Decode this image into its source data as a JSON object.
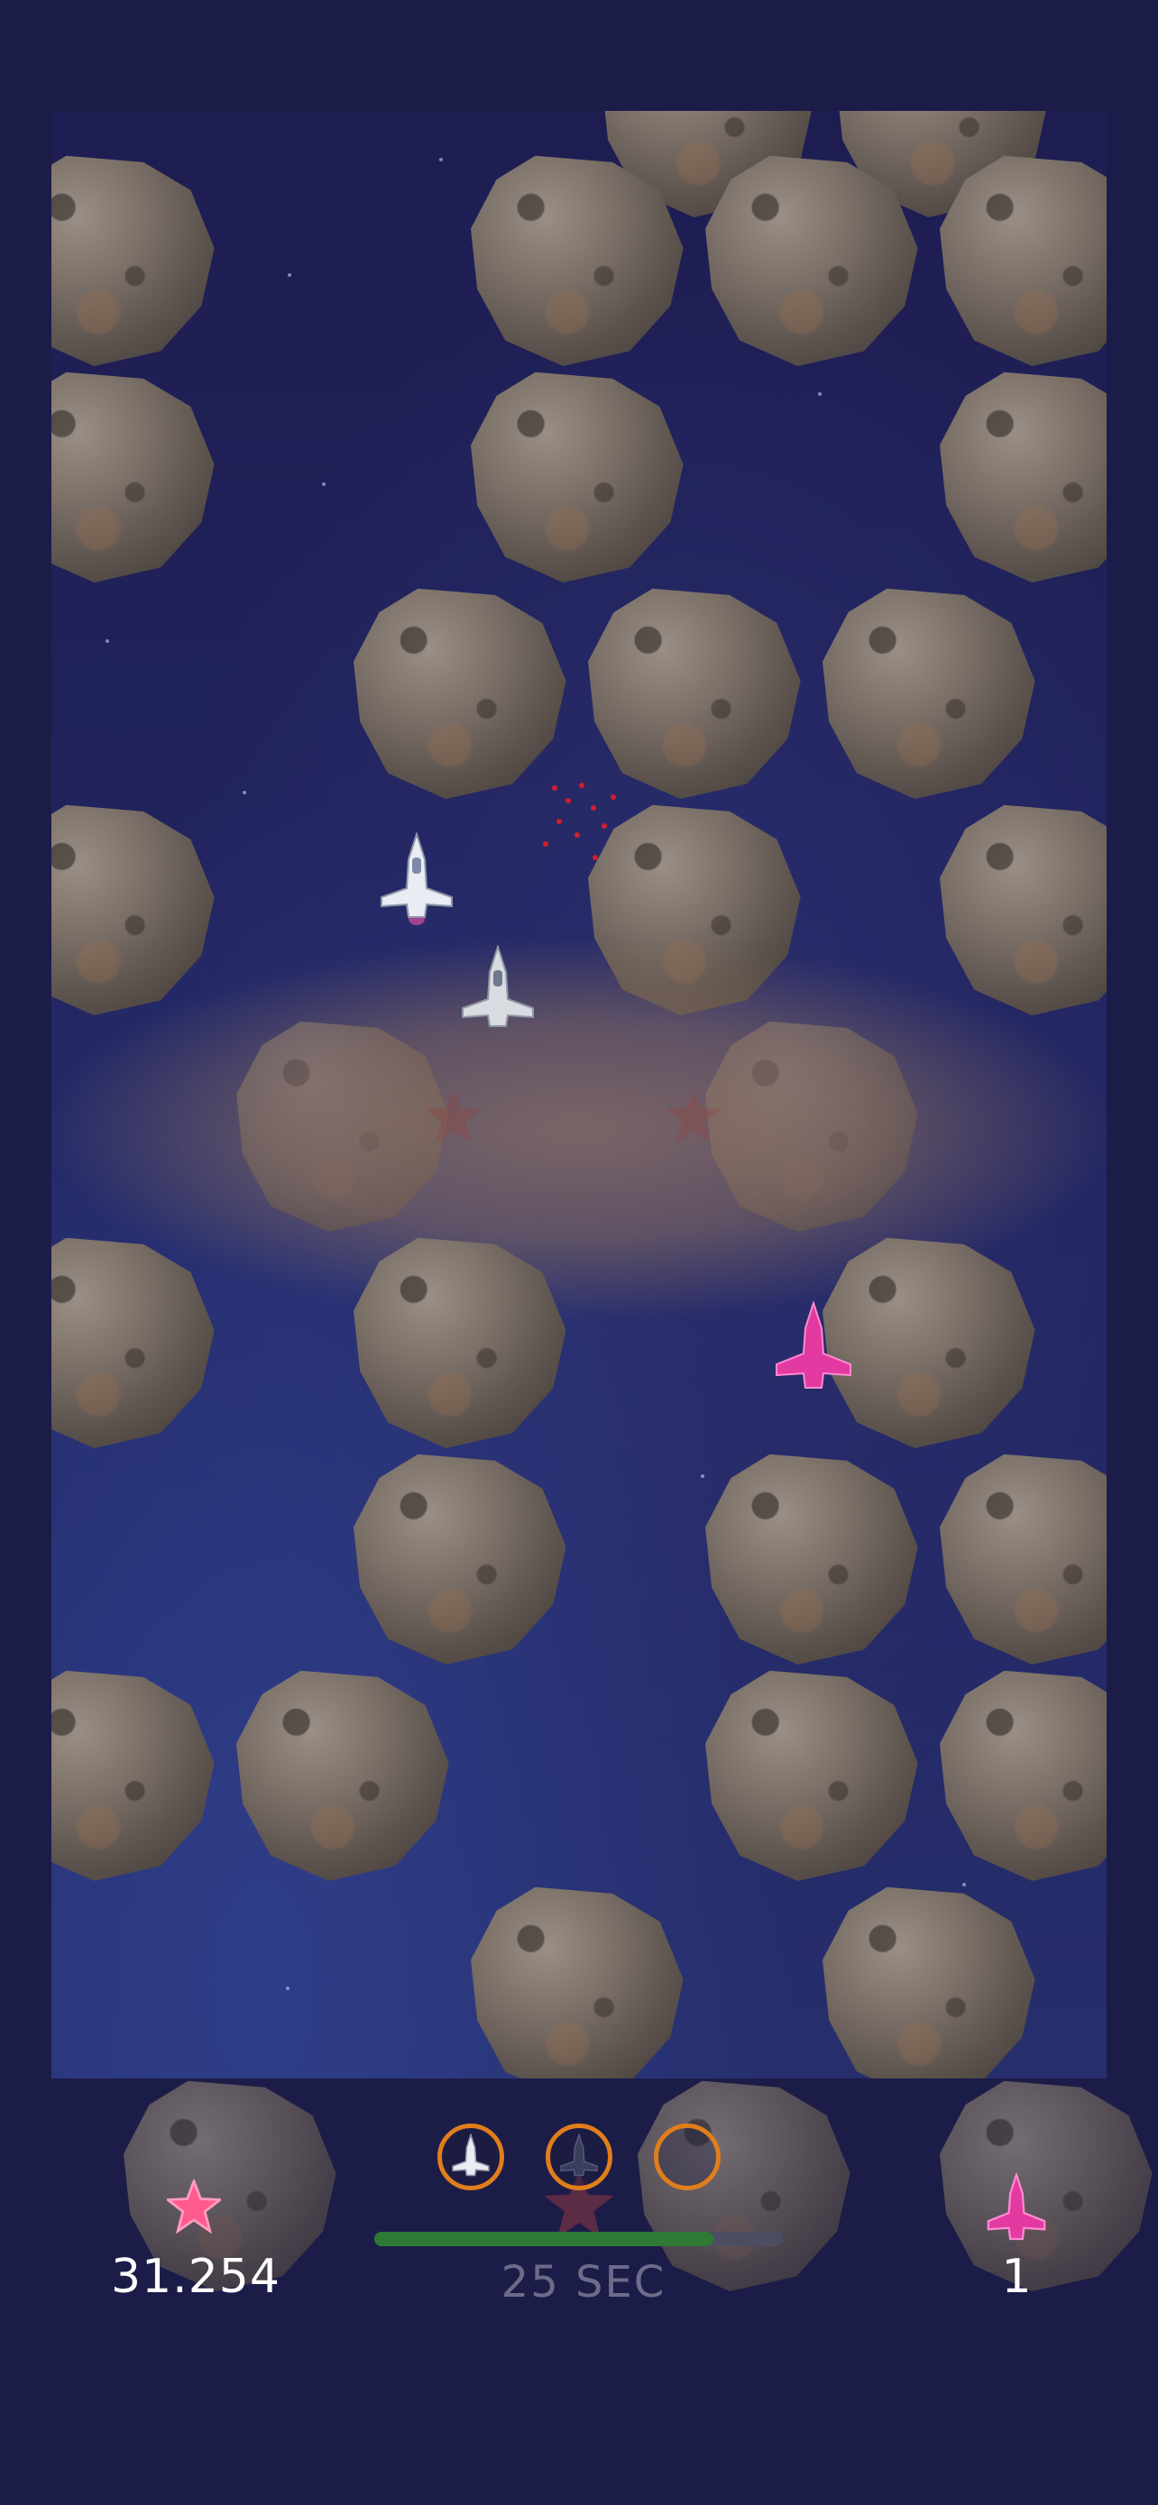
{
  "hud": {
    "score": "31.254",
    "timer": "25 SEC",
    "lives": "1",
    "progress": 0.83,
    "ship_slots": [
      {
        "name": "slot-1",
        "state": "active"
      },
      {
        "name": "slot-2",
        "state": "locked"
      },
      {
        "name": "slot-3",
        "state": "empty"
      }
    ]
  },
  "colors": {
    "background": "#1c1c48",
    "score_star": "#ff3d7a",
    "enemy_ship": "#e23aa0",
    "progress_fill": "#2e7a34",
    "slot_ring": "#e07e1c",
    "timer_text": "#6c6c8a"
  },
  "icons": {
    "score": "pink-star-icon",
    "lives": "magenta-ship-icon",
    "player": "white-spaceship-icon"
  }
}
